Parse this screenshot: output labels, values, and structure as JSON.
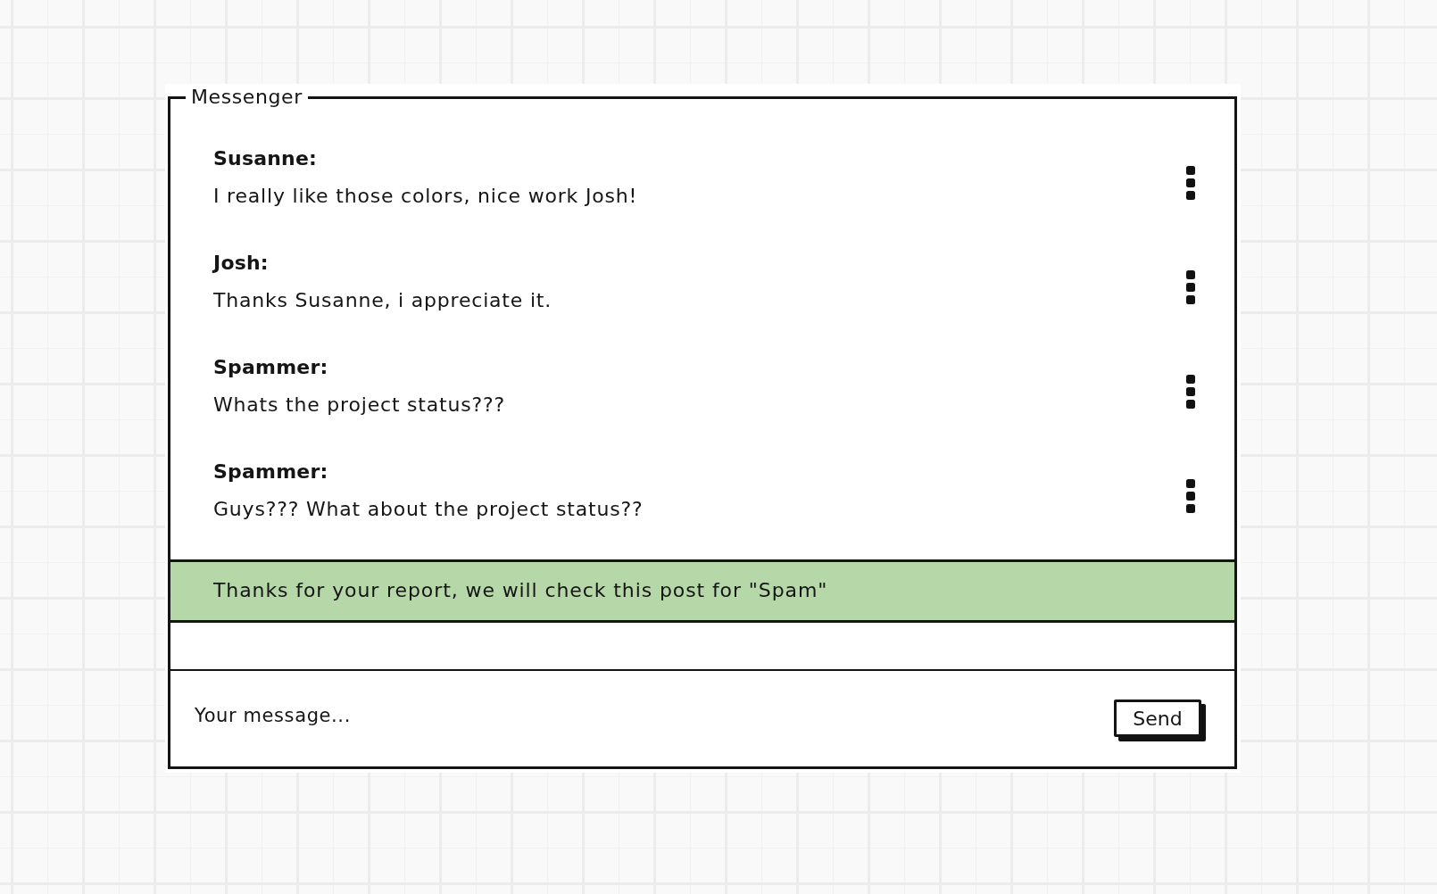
{
  "window": {
    "title": "Messenger"
  },
  "messages": [
    {
      "author": "Susanne:",
      "text": "I really like those colors, nice work Josh!"
    },
    {
      "author": "Josh:",
      "text": "Thanks Susanne, i appreciate it."
    },
    {
      "author": "Spammer:",
      "text": "Whats the project status???"
    },
    {
      "author": "Spammer:",
      "text": "Guys??? What about the project status??"
    }
  ],
  "notice": {
    "text": "Thanks for your report, we will check this post for \"Spam\""
  },
  "composer": {
    "placeholder": "Your message...",
    "send_button": "Send"
  }
}
